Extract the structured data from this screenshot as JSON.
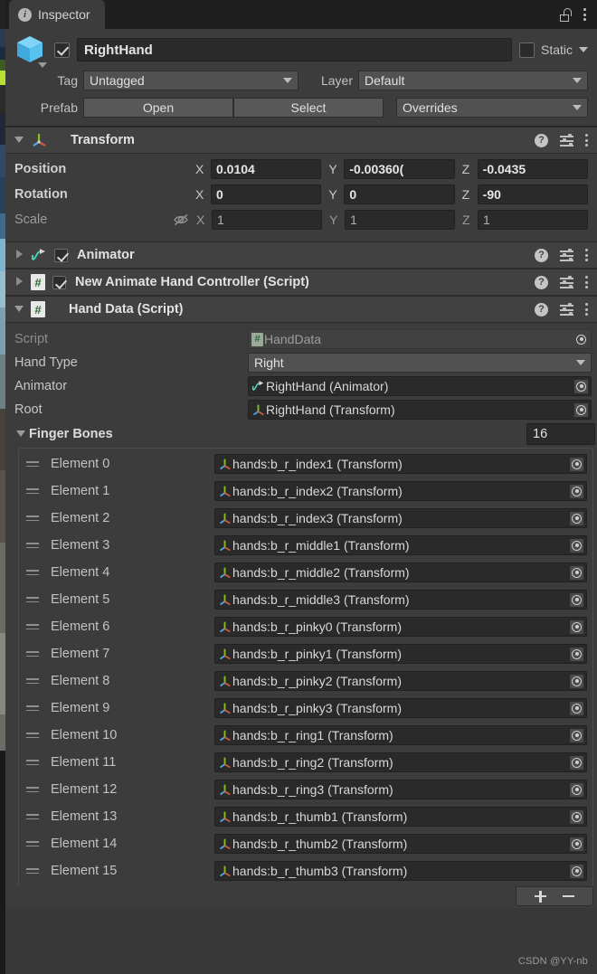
{
  "window": {
    "tab_label": "Inspector",
    "tab_icon": "info-icon",
    "lock_icon": "lock-open-icon",
    "menu_icon": "kebab-menu-icon"
  },
  "header": {
    "object_icon": "cube-prefab-icon",
    "enabled": true,
    "name": "RightHand",
    "static_label": "Static",
    "tag_label": "Tag",
    "tag_value": "Untagged",
    "layer_label": "Layer",
    "layer_value": "Default",
    "prefab_label": "Prefab",
    "open_label": "Open",
    "select_label": "Select",
    "overrides_label": "Overrides"
  },
  "components": [
    {
      "name": "transform-component",
      "title": "Transform",
      "icon": "transform-axis-icon",
      "expanded": true,
      "has_toggle": false,
      "help_icon": "help-icon",
      "preset_icon": "preset-icon",
      "menu_icon": "kebab-menu-icon"
    },
    {
      "name": "animator-component",
      "title": "Animator",
      "icon": "animator-icon",
      "expanded": false,
      "has_toggle": true,
      "enabled": true
    },
    {
      "name": "new-animate-hand-controller-component",
      "title": "New Animate Hand Controller (Script)",
      "icon": "cs-script-icon",
      "expanded": false,
      "has_toggle": true,
      "enabled": true
    },
    {
      "name": "hand-data-component",
      "title": "Hand Data (Script)",
      "icon": "cs-script-icon",
      "expanded": true,
      "has_toggle": false
    }
  ],
  "transform": {
    "rows": [
      {
        "label": "Position",
        "x": "0.0104",
        "y": "-0.00360(",
        "z": "-0.0435",
        "disabled": false
      },
      {
        "label": "Rotation",
        "x": "0",
        "y": "0",
        "z": "-90",
        "disabled": false
      },
      {
        "label": "Scale",
        "x": "1",
        "y": "1",
        "z": "1",
        "disabled": true,
        "icon": "eye-off-icon"
      }
    ],
    "axis_labels": [
      "X",
      "Y",
      "Z"
    ]
  },
  "hand_data": {
    "script_label": "Script",
    "script_value": "HandData",
    "script_icon": "cs-script-icon",
    "hand_type_label": "Hand Type",
    "hand_type_value": "Right",
    "animator_label": "Animator",
    "animator_value": "RightHand (Animator)",
    "animator_value_icon": "animator-icon",
    "root_label": "Root",
    "root_value": "RightHand (Transform)",
    "root_value_icon": "transform-axis-icon",
    "finger_bones_label": "Finger Bones",
    "finger_bones_size": "16",
    "elements": [
      {
        "label": "Element 0",
        "value": "hands:b_r_index1 (Transform)"
      },
      {
        "label": "Element 1",
        "value": "hands:b_r_index2 (Transform)"
      },
      {
        "label": "Element 2",
        "value": "hands:b_r_index3 (Transform)"
      },
      {
        "label": "Element 3",
        "value": "hands:b_r_middle1 (Transform)"
      },
      {
        "label": "Element 4",
        "value": "hands:b_r_middle2 (Transform)"
      },
      {
        "label": "Element 5",
        "value": "hands:b_r_middle3 (Transform)"
      },
      {
        "label": "Element 6",
        "value": "hands:b_r_pinky0 (Transform)"
      },
      {
        "label": "Element 7",
        "value": "hands:b_r_pinky1 (Transform)"
      },
      {
        "label": "Element 8",
        "value": "hands:b_r_pinky2 (Transform)"
      },
      {
        "label": "Element 9",
        "value": "hands:b_r_pinky3 (Transform)"
      },
      {
        "label": "Element 10",
        "value": "hands:b_r_ring1 (Transform)"
      },
      {
        "label": "Element 11",
        "value": "hands:b_r_ring2 (Transform)"
      },
      {
        "label": "Element 12",
        "value": "hands:b_r_ring3 (Transform)"
      },
      {
        "label": "Element 13",
        "value": "hands:b_r_thumb1 (Transform)"
      },
      {
        "label": "Element 14",
        "value": "hands:b_r_thumb2 (Transform)"
      },
      {
        "label": "Element 15",
        "value": "hands:b_r_thumb3 (Transform)"
      }
    ],
    "add_icon": "plus-icon",
    "remove_icon": "minus-icon"
  },
  "watermark": "CSDN @YY-nb",
  "colors": {
    "panel_bg": "#383838",
    "header_bg": "#3c3c3c",
    "comp_header_bg": "#414141",
    "field_bg": "#2a2a2a",
    "dropdown_bg": "#515151",
    "text": "#c9c9c9",
    "axis_green": "#88c020",
    "axis_blue": "#4fa8e0",
    "axis_red": "#d05a3a",
    "script_green": "#2f6b35",
    "animator_teal": "#4fd6c0",
    "cube_blue": "#58c1f0"
  }
}
